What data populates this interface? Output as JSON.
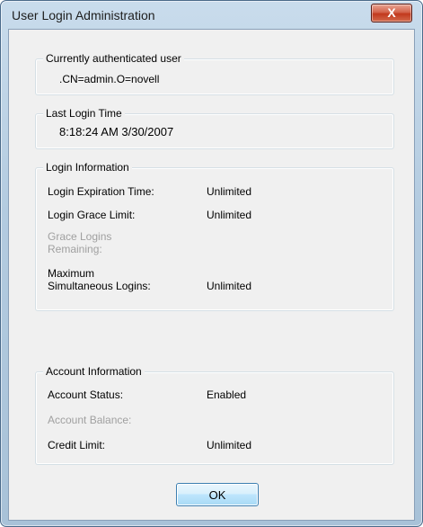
{
  "window": {
    "title": "User Login Administration",
    "close_glyph": "X"
  },
  "current_user": {
    "label": "Currently authenticated user",
    "value": ".CN=admin.O=novell"
  },
  "last_login": {
    "label": "Last Login Time",
    "value": "8:18:24 AM 3/30/2007"
  },
  "login_info": {
    "label": "Login Information",
    "expiration_label": "Login Expiration Time:",
    "expiration_value": "Unlimited",
    "grace_limit_label": "Login Grace Limit:",
    "grace_limit_value": "Unlimited",
    "grace_remaining_line1": "Grace Logins",
    "grace_remaining_line2": "Remaining:",
    "max_simultaneous_line1": "Maximum",
    "max_simultaneous_line2": "Simultaneous Logins:",
    "max_simultaneous_value": "Unlimited"
  },
  "account_info": {
    "label": "Account Information",
    "status_label": "Account Status:",
    "status_value": "Enabled",
    "balance_label": "Account Balance:",
    "credit_limit_label": "Credit Limit:",
    "credit_limit_value": "Unlimited"
  },
  "buttons": {
    "ok_label": "OK"
  }
}
